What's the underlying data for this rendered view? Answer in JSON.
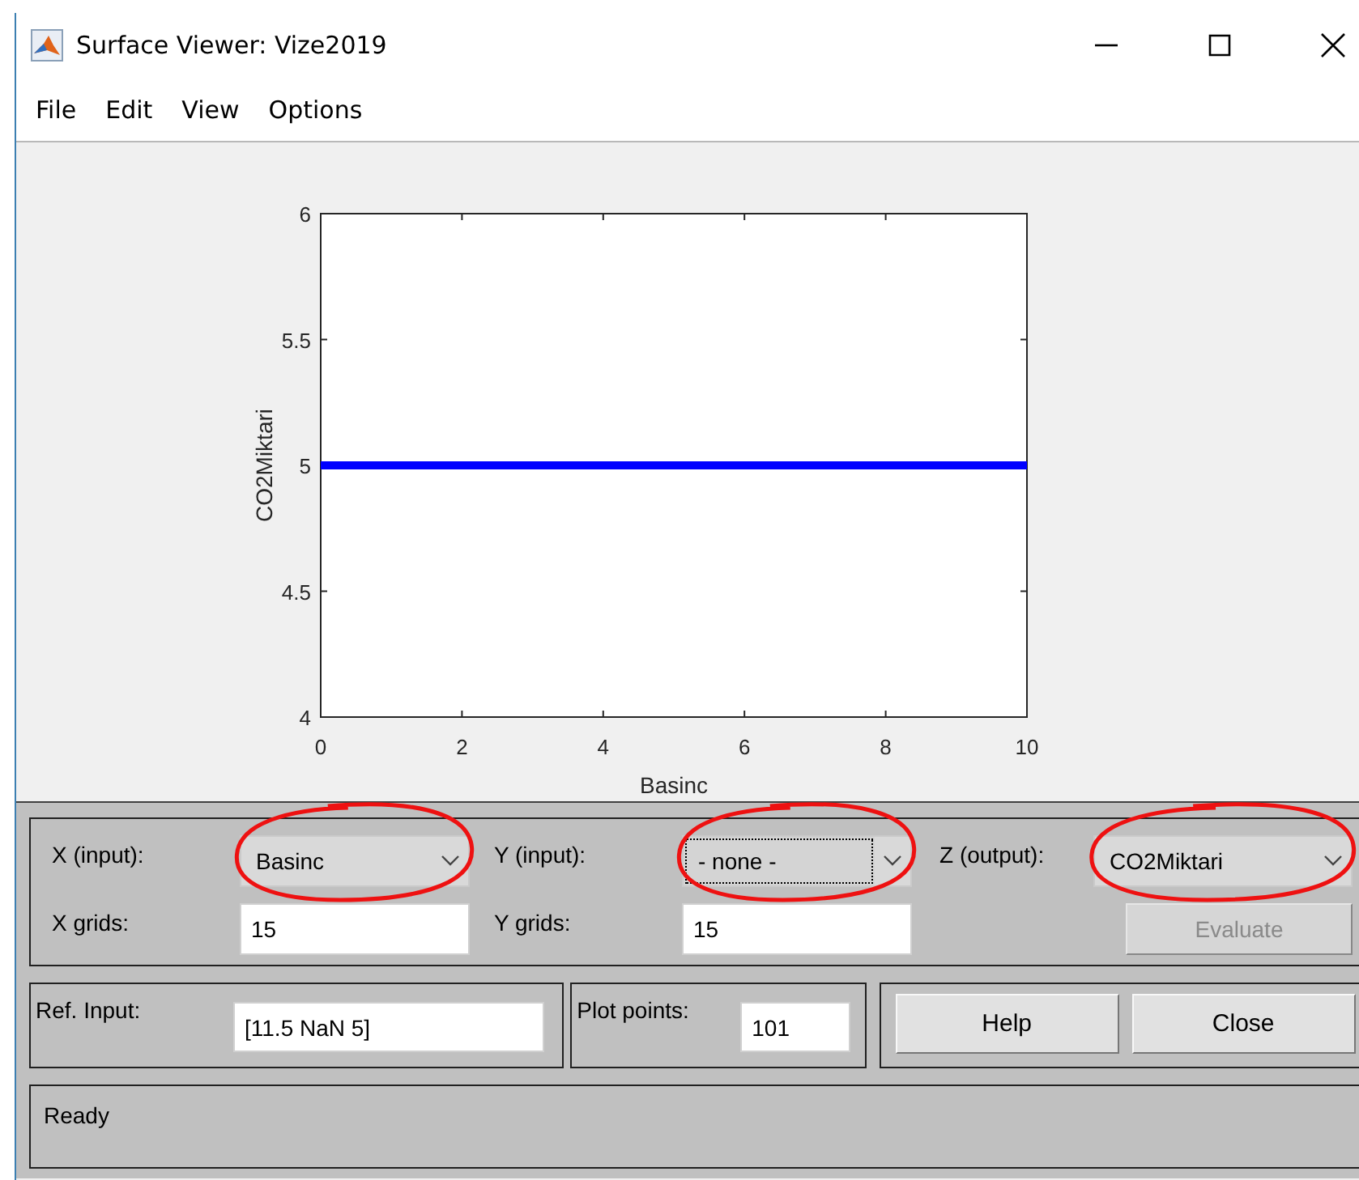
{
  "window": {
    "title": "Surface Viewer: Vize2019"
  },
  "menu": [
    "File",
    "Edit",
    "View",
    "Options"
  ],
  "plot": {
    "chart_data": {
      "type": "line",
      "xlabel": "Basinc",
      "ylabel": "CO2Miktari",
      "x": [
        0,
        10
      ],
      "series": [
        {
          "color": "#0000ff",
          "values": [
            5,
            5
          ]
        }
      ],
      "xlim": [
        0,
        10
      ],
      "ylim": [
        4,
        6
      ],
      "xticks": [
        0,
        2,
        4,
        6,
        8,
        10
      ],
      "yticks": [
        4,
        4.5,
        5,
        5.5,
        6
      ]
    }
  },
  "axes_panel": {
    "selectors": [
      {
        "label": "X (input):",
        "value": "Basinc",
        "focused": false,
        "circled": true
      },
      {
        "label": "Y (input):",
        "value": "- none -",
        "focused": true,
        "circled": true
      },
      {
        "label": "Z (output):",
        "value": "CO2Miktari",
        "focused": false,
        "circled": true
      }
    ],
    "grids": [
      {
        "label": "X grids:",
        "value": "15"
      },
      {
        "label": "Y grids:",
        "value": "15"
      }
    ],
    "evaluate": {
      "label": "Evaluate",
      "disabled": true
    }
  },
  "ref_panel": {
    "label": "Ref. Input:",
    "value": "[11.5 NaN 5]"
  },
  "points_panel": {
    "label": "Plot points:",
    "value": "101"
  },
  "buttons": [
    "Help",
    "Close"
  ],
  "status": "Ready"
}
